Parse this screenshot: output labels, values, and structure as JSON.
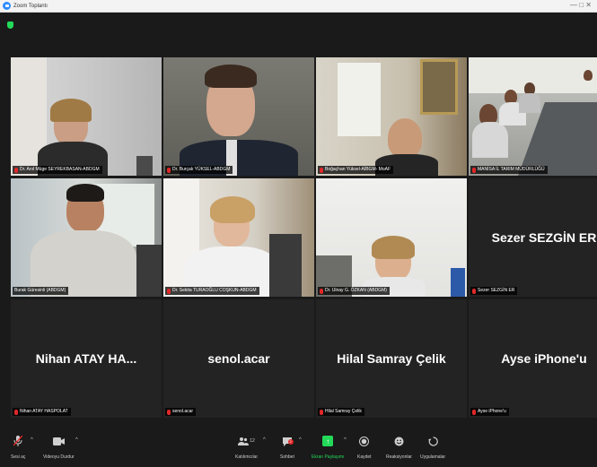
{
  "window": {
    "title": "Zoom Toplantı",
    "controls": "— □ ✕"
  },
  "tiles": [
    {
      "name": "Dr. Anıl Müge SEYREKBASAN-ABDGM",
      "type": "video"
    },
    {
      "name": "Dr. Burçak YÜKSEL-ABDGM",
      "type": "video"
    },
    {
      "name": "Boğaçhan Yüksel-AİBGM- MoAF",
      "type": "video"
    },
    {
      "name": "MANİSA İL TARIM MÜDÜRLÜĞÜ",
      "type": "video"
    },
    {
      "name": "Burak Güresinli (ABDGM)",
      "type": "video",
      "active": true
    },
    {
      "name": "Dr. Sekita TURAOĞLU COŞKUN-ABDGM",
      "type": "video"
    },
    {
      "name": "Dr. Ulnay G. ÖZKAN (ABDGM)",
      "type": "video"
    },
    {
      "name": "Sezer SEZGİN ER",
      "display": "Sezer SEZGİN ER",
      "type": "name"
    },
    {
      "name": "Nihan ATAY HASPOLAT",
      "display": "Nihan ATAY HA...",
      "type": "name"
    },
    {
      "name": "senol.acar",
      "display": "senol.acar",
      "type": "name"
    },
    {
      "name": "Hilal Samray Çelik",
      "display": "Hilal Samray Çelik",
      "type": "name"
    },
    {
      "name": "Ayse iPhone'u",
      "display": "Ayse iPhone'u",
      "type": "name"
    }
  ],
  "toolbar": {
    "mute": "Sesi aç",
    "video": "Videoyu Durdur",
    "participants": "Katılımcılar",
    "participants_count": "12",
    "chat": "Sohbet",
    "chat_badge": "2",
    "share": "Ekran Paylaşımı",
    "record": "Kaydet",
    "reactions": "Reaksiyonlar",
    "apps": "Uygulamalar"
  }
}
